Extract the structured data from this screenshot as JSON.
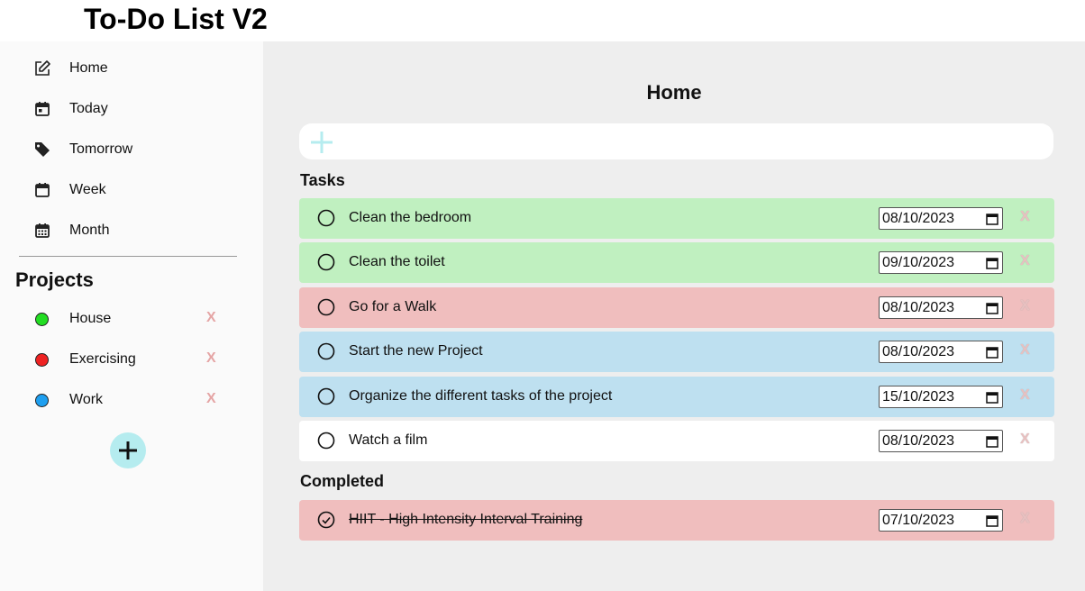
{
  "header": {
    "title": "To-Do List V2"
  },
  "sidebar": {
    "nav": [
      {
        "label": "Home",
        "icon": "edit-icon"
      },
      {
        "label": "Today",
        "icon": "calendar-today-icon"
      },
      {
        "label": "Tomorrow",
        "icon": "tag-icon"
      },
      {
        "label": "Week",
        "icon": "calendar-week-icon"
      },
      {
        "label": "Month",
        "icon": "calendar-month-icon"
      }
    ],
    "projects_title": "Projects",
    "projects": [
      {
        "label": "House",
        "color": "#22dd22",
        "delete": "X"
      },
      {
        "label": "Exercising",
        "color": "#ee2222",
        "delete": "X"
      },
      {
        "label": "Work",
        "color": "#1e9ff0",
        "delete": "X"
      }
    ]
  },
  "main": {
    "title": "Home",
    "tasks_title": "Tasks",
    "completed_title": "Completed",
    "tasks": [
      {
        "label": "Clean the bedroom",
        "date": "08/10/2023",
        "color": "#c0f0c0",
        "delete": "X"
      },
      {
        "label": "Clean the toilet",
        "date": "09/10/2023",
        "color": "#c0f0c0",
        "delete": "X"
      },
      {
        "label": "Go for a Walk",
        "date": "08/10/2023",
        "color": "#f0bebe",
        "delete": "X"
      },
      {
        "label": "Start the new Project",
        "date": "08/10/2023",
        "color": "#bee0f0",
        "delete": "X"
      },
      {
        "label": "Organize the different tasks of the project",
        "date": "15/10/2023",
        "color": "#bee0f0",
        "delete": "X"
      },
      {
        "label": "Watch a film",
        "date": "08/10/2023",
        "color": "#ffffff",
        "delete": "X"
      }
    ],
    "completed": [
      {
        "label": "HIIT - High Intensity Interval Training",
        "date": "07/10/2023",
        "color": "#f0bebe",
        "delete": "X"
      }
    ]
  },
  "colors": {
    "accent": "#b5ecef",
    "main_bg": "#eeeeee",
    "sidebar_bg": "#fafafa",
    "delete": "#e5a5a5"
  }
}
